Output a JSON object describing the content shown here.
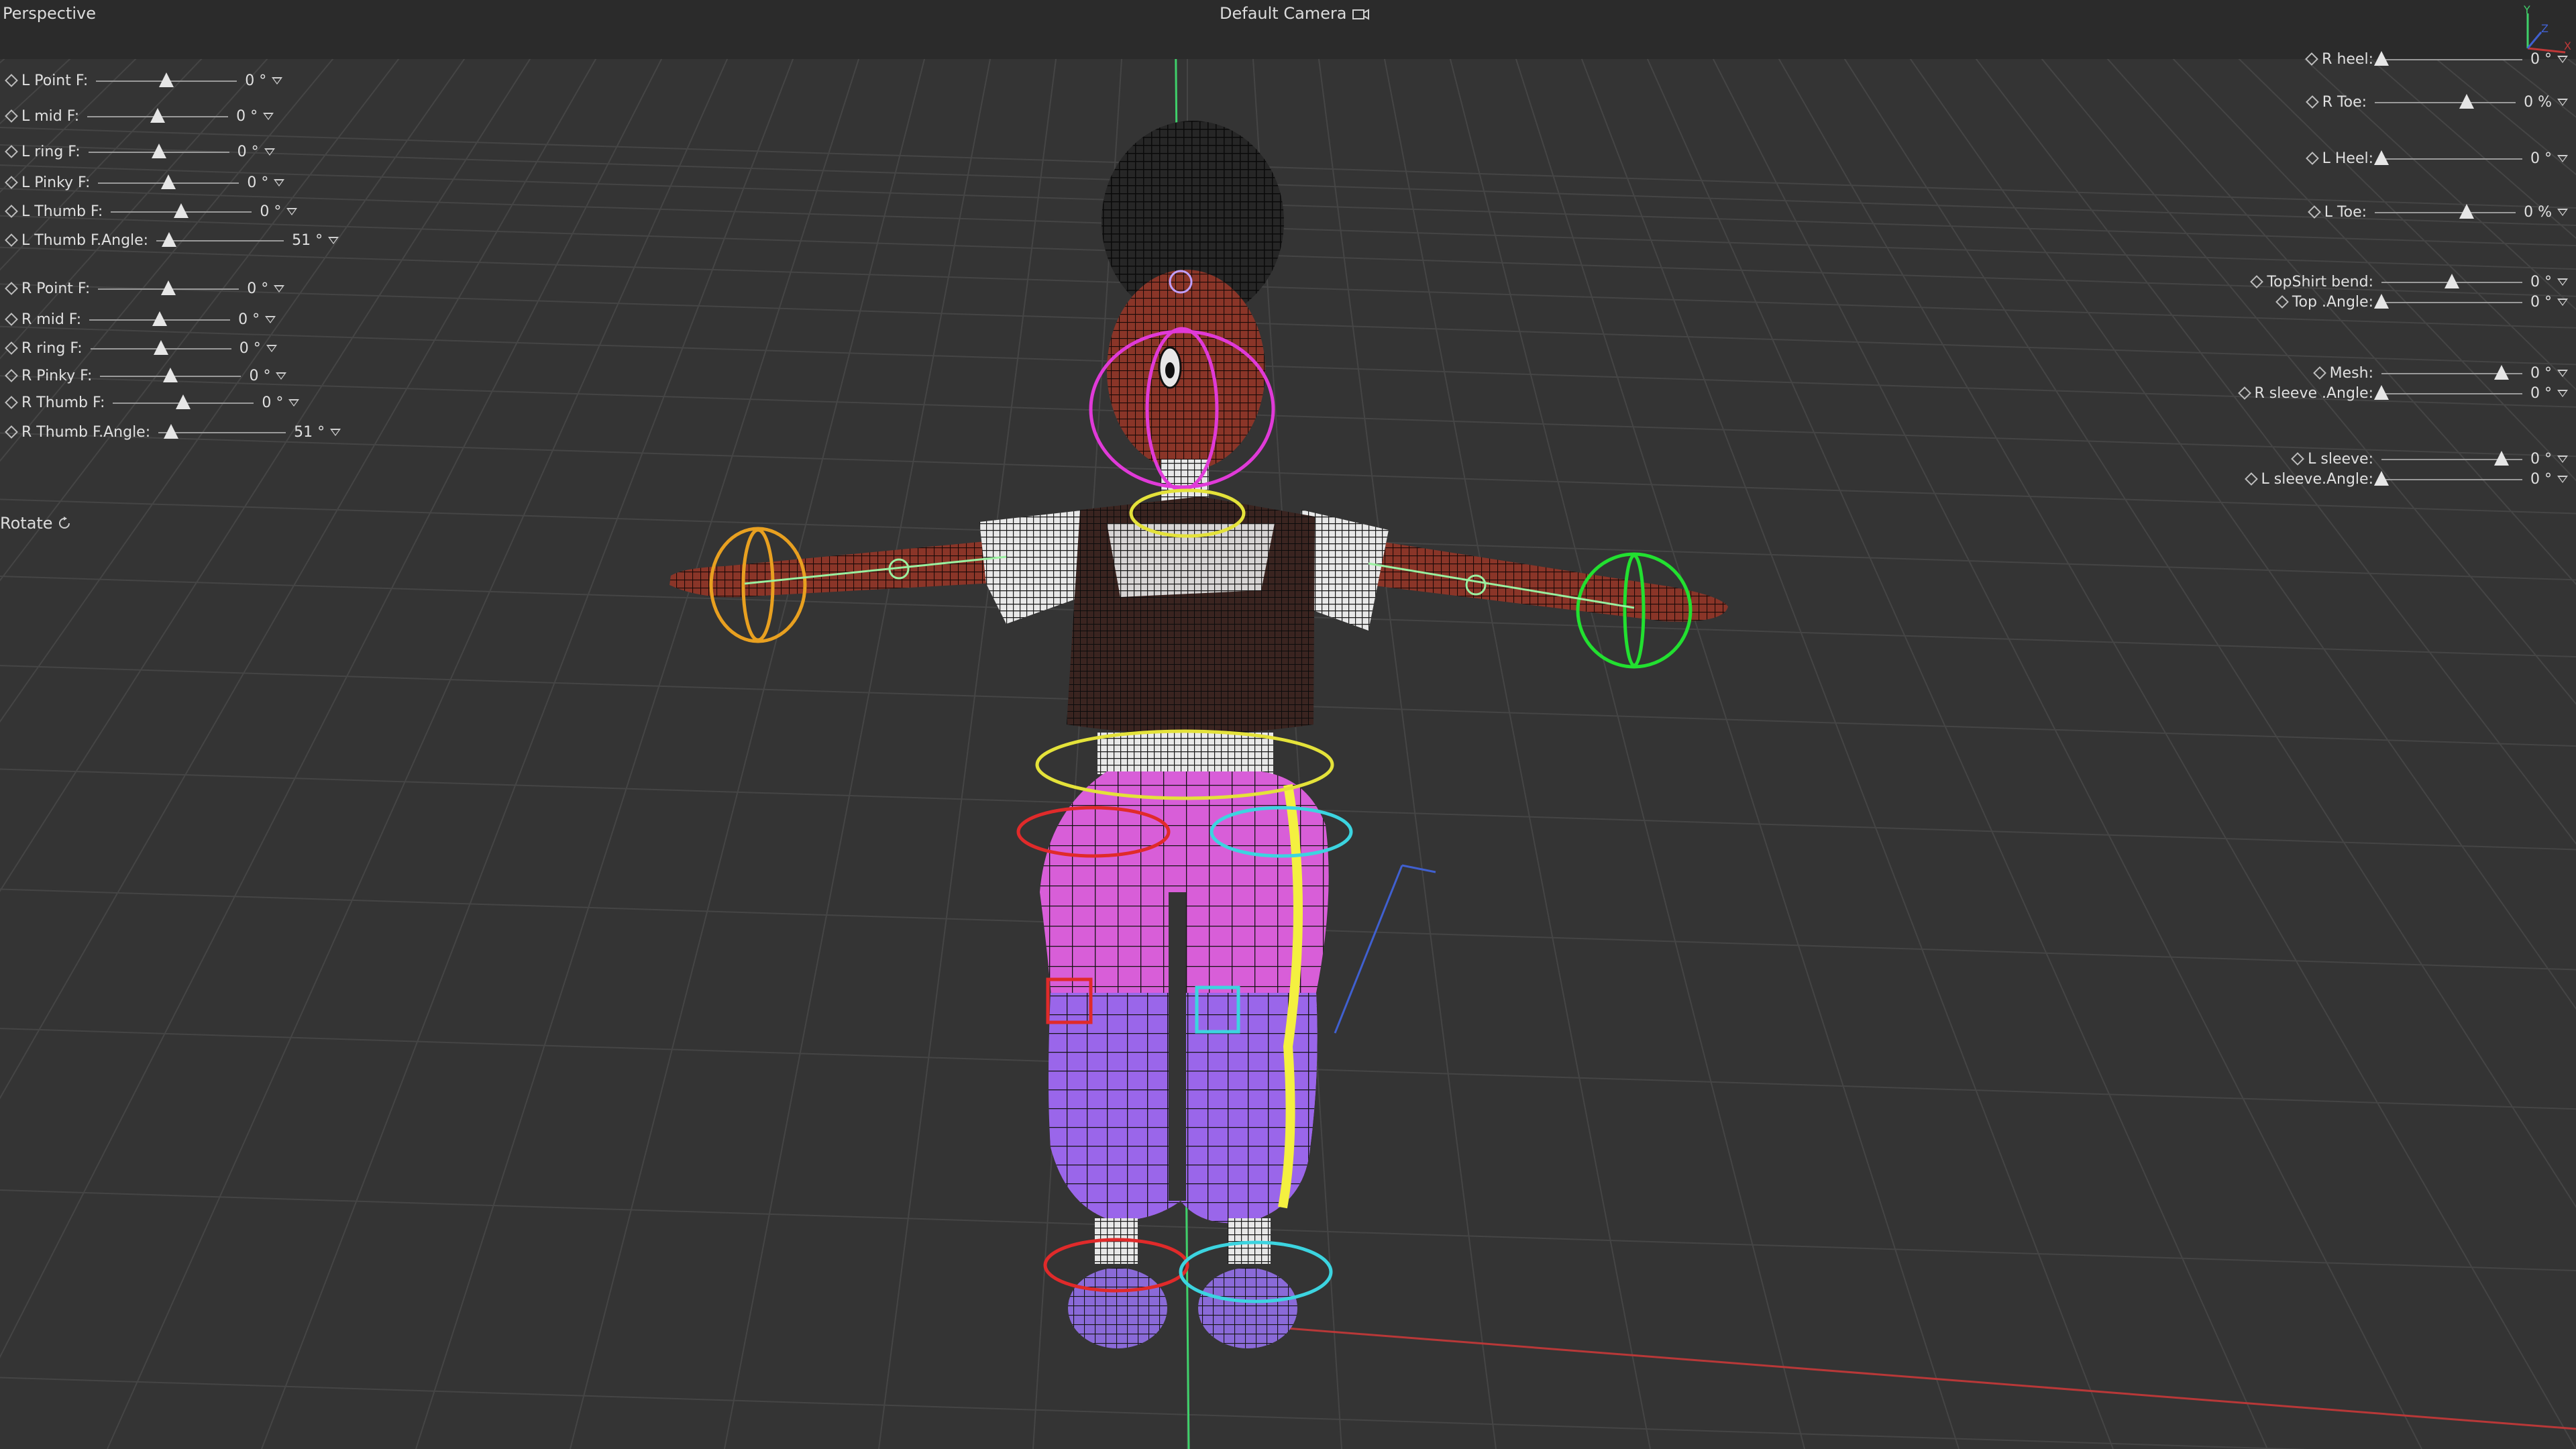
{
  "viewport": {
    "view_mode": "Perspective",
    "camera": "Default Camera",
    "tool": "Rotate",
    "axis_labels": [
      "Y",
      "Z",
      "X"
    ]
  },
  "left_controls": [
    {
      "label": "L Point F:",
      "value": "0 °",
      "fraction": 0.5
    },
    {
      "label": "L mid F:",
      "value": "0 °",
      "fraction": 0.5
    },
    {
      "label": "L ring F:",
      "value": "0 °",
      "fraction": 0.5
    },
    {
      "label": "L Pinky F:",
      "value": "0 °",
      "fraction": 0.5
    },
    {
      "label": "L Thumb F:",
      "value": "0 °",
      "fraction": 0.5
    },
    {
      "label": "L Thumb F.Angle:",
      "value": "51 °",
      "fraction": 0.1
    },
    {
      "label": "R Point F:",
      "value": "0 °",
      "fraction": 0.5
    },
    {
      "label": "R mid F:",
      "value": "0 °",
      "fraction": 0.5
    },
    {
      "label": "R ring F:",
      "value": "0 °",
      "fraction": 0.5
    },
    {
      "label": "R Pinky F:",
      "value": "0 °",
      "fraction": 0.5
    },
    {
      "label": "R Thumb F:",
      "value": "0 °",
      "fraction": 0.5
    },
    {
      "label": "R Thumb F.Angle:",
      "value": "51 °",
      "fraction": 0.1
    }
  ],
  "right_controls": [
    {
      "label": "R heel:",
      "value": "0 °",
      "fraction": 0.0
    },
    {
      "label": "R Toe:",
      "value": "0 %",
      "fraction": 0.65
    },
    {
      "label": "L Heel:",
      "value": "0 °",
      "fraction": 0.0
    },
    {
      "label": "L Toe:",
      "value": "0 %",
      "fraction": 0.65
    },
    {
      "label": "TopShirt bend:",
      "value": "0 °",
      "fraction": 0.5
    },
    {
      "label": "Top .Angle:",
      "value": "0 °",
      "fraction": 0.0
    },
    {
      "label": "Mesh:",
      "value": "0 °",
      "fraction": 0.85
    },
    {
      "label": "R sleeve .Angle:",
      "value": "0 °",
      "fraction": 0.0
    },
    {
      "label": "L sleeve:",
      "value": "0 °",
      "fraction": 0.85
    },
    {
      "label": "L sleeve.Angle:",
      "value": "0 °",
      "fraction": 0.0
    }
  ],
  "colors": {
    "background": "#343434",
    "grid": "#454545",
    "skin": "#8a3528",
    "pants_pink": "#d85ed8",
    "pants_purple": "#9a66ea",
    "wire": "#111111",
    "rig_yellow": "#e4e23a",
    "rig_cyan": "#3cd4e0",
    "rig_red": "#e02a2a",
    "rig_magenta": "#e03ad8",
    "rig_orange": "#e8a020",
    "rig_green": "#22e030",
    "axis_green": "#3fd06a",
    "axis_red": "#c03838",
    "axis_blue": "#4060d0"
  }
}
